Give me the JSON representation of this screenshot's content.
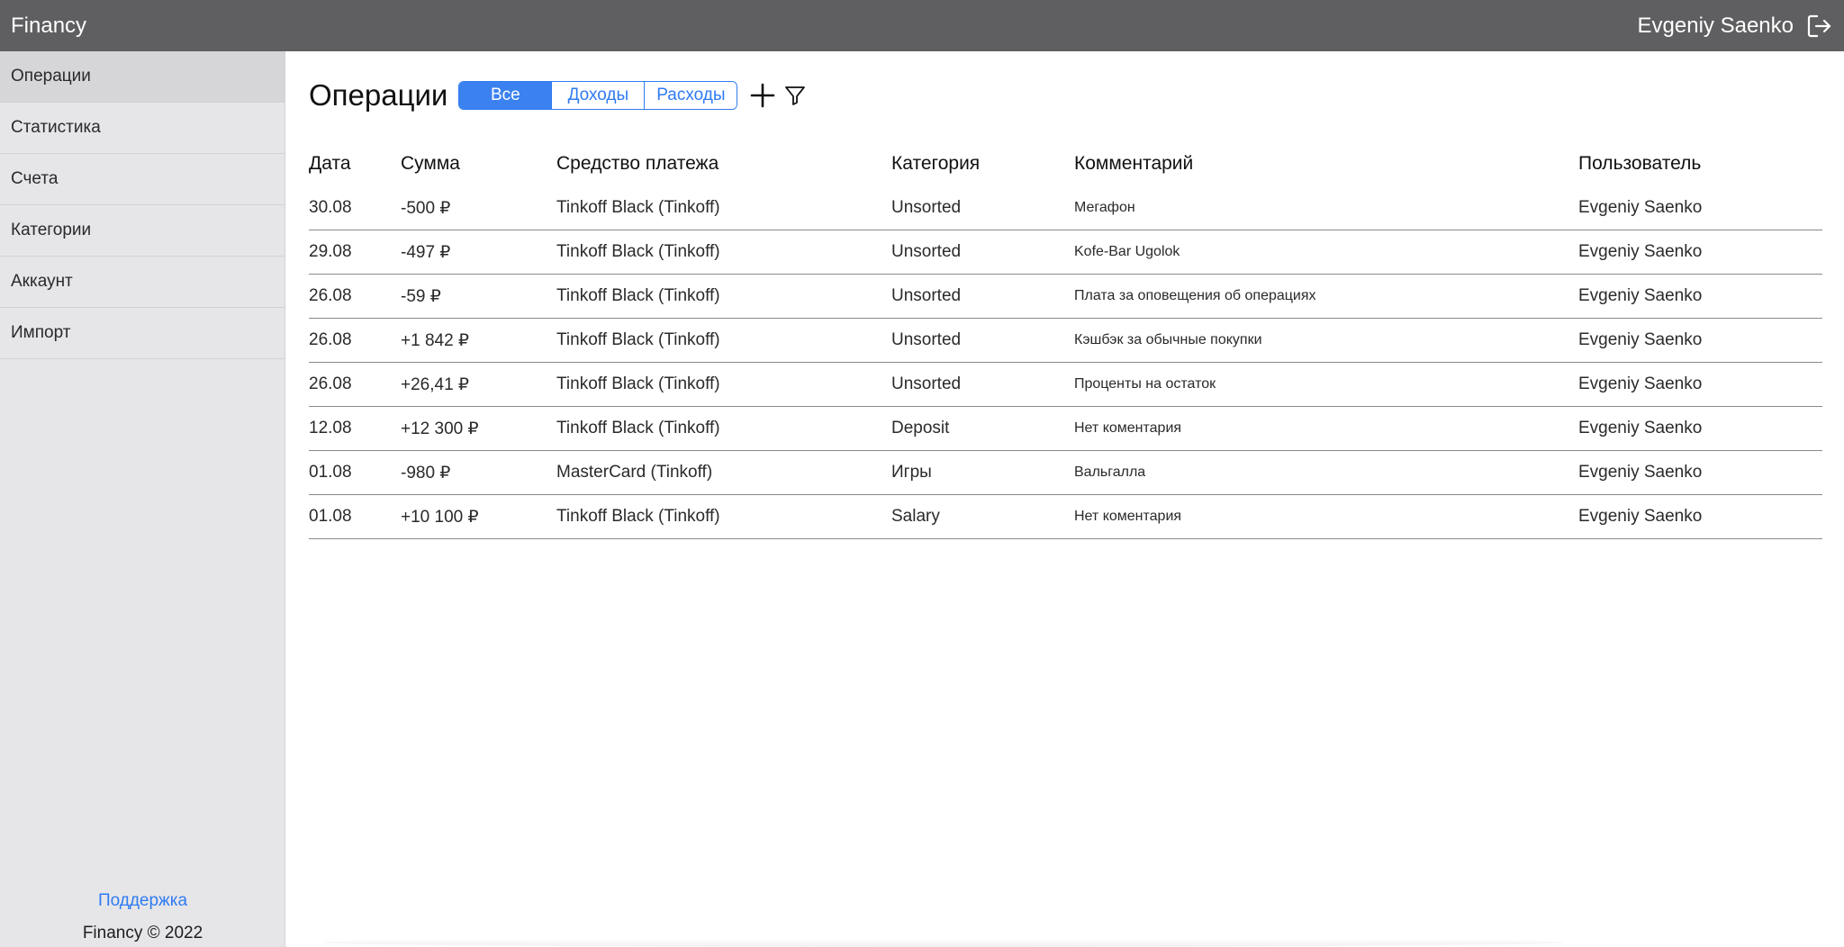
{
  "app": {
    "brand": "Financy",
    "user_name": "Evgeniy Saenko",
    "logout_icon": "logout-icon"
  },
  "sidebar": {
    "items": [
      {
        "label": "Операции",
        "active": true
      },
      {
        "label": "Статистика",
        "active": false
      },
      {
        "label": "Счета",
        "active": false
      },
      {
        "label": "Категории",
        "active": false
      },
      {
        "label": "Аккаунт",
        "active": false
      },
      {
        "label": "Импорт",
        "active": false
      }
    ],
    "support_label": "Поддержка",
    "copyright": "Financy © 2022"
  },
  "main": {
    "title": "Операции",
    "segments": [
      {
        "label": "Все",
        "active": true
      },
      {
        "label": "Доходы",
        "active": false
      },
      {
        "label": "Расходы",
        "active": false
      }
    ],
    "add_icon": "plus-icon",
    "filter_icon": "filter-icon"
  },
  "table": {
    "headers": [
      "Дата",
      "Сумма",
      "Средство платежа",
      "Категория",
      "Комментарий",
      "Пользователь"
    ],
    "rows": [
      {
        "date": "30.08",
        "amount": "-500 ₽",
        "type": "neg",
        "payment": "Tinkoff Black (Tinkoff)",
        "category": "Unsorted",
        "comment": "Мегафон",
        "user": "Evgeniy Saenko"
      },
      {
        "date": "29.08",
        "amount": "-497 ₽",
        "type": "neg",
        "payment": "Tinkoff Black (Tinkoff)",
        "category": "Unsorted",
        "comment": "Kofe-Bar Ugolok",
        "user": "Evgeniy Saenko"
      },
      {
        "date": "26.08",
        "amount": "-59 ₽",
        "type": "neg",
        "payment": "Tinkoff Black (Tinkoff)",
        "category": "Unsorted",
        "comment": "Плата за оповещения об операциях",
        "user": "Evgeniy Saenko"
      },
      {
        "date": "26.08",
        "amount": "+1 842 ₽",
        "type": "pos",
        "payment": "Tinkoff Black (Tinkoff)",
        "category": "Unsorted",
        "comment": "Кэшбэк за обычные покупки",
        "user": "Evgeniy Saenko"
      },
      {
        "date": "26.08",
        "amount": "+26,41 ₽",
        "type": "pos",
        "payment": "Tinkoff Black (Tinkoff)",
        "category": "Unsorted",
        "comment": "Проценты на остаток",
        "user": "Evgeniy Saenko"
      },
      {
        "date": "12.08",
        "amount": "+12 300 ₽",
        "type": "pos",
        "payment": "Tinkoff Black (Tinkoff)",
        "category": "Deposit",
        "comment": "Нет коментария",
        "user": "Evgeniy Saenko"
      },
      {
        "date": "01.08",
        "amount": "-980 ₽",
        "type": "neg",
        "payment": "MasterCard (Tinkoff)",
        "category": "Игры",
        "comment": "Вальгалла",
        "user": "Evgeniy Saenko"
      },
      {
        "date": "01.08",
        "amount": "+10 100 ₽",
        "type": "pos",
        "payment": "Tinkoff Black (Tinkoff)",
        "category": "Salary",
        "comment": "Нет коментария",
        "user": "Evgeniy Saenko"
      }
    ]
  },
  "colors": {
    "topbar": "#5f5f61",
    "sidebar": "#e6e6e8",
    "accent": "#2f7bf2",
    "negative": "#e2502a",
    "positive": "#6cc451"
  }
}
